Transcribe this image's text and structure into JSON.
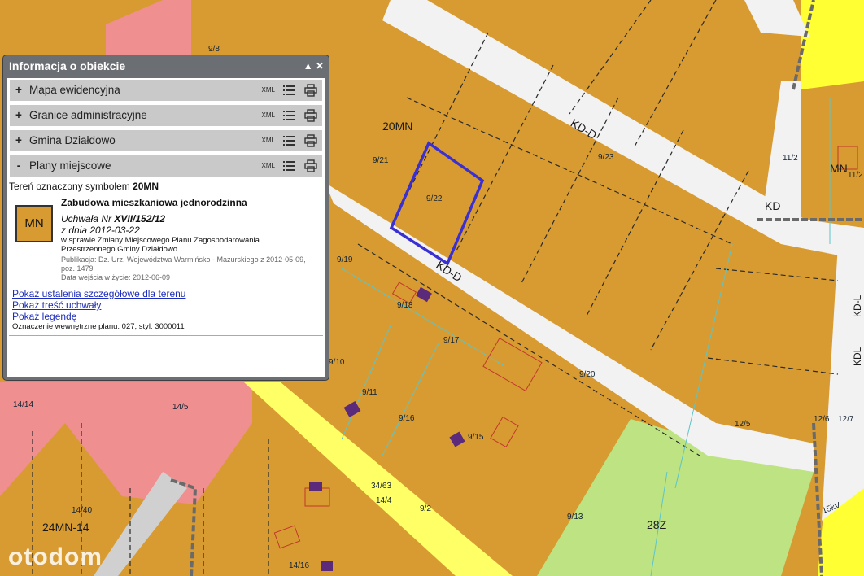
{
  "panel": {
    "title": "Informacja o obiekcie",
    "sections": [
      {
        "sign": "+",
        "title": "Mapa ewidencyjna",
        "xml": "XML"
      },
      {
        "sign": "+",
        "title": "Granice administracyjne",
        "xml": "XML"
      },
      {
        "sign": "+",
        "title": "Gmina Działdowo",
        "xml": "XML"
      },
      {
        "sign": "-",
        "title": "Plany miejscowe",
        "xml": "XML"
      }
    ],
    "details": {
      "symbol_prefix": "Tereń oznaczony symbolem",
      "symbol": "20MN",
      "zone_code": "MN",
      "zone_title": "Zabudowa mieszkaniowa jednorodzinna",
      "resolution_prefix": "Uchwała Nr",
      "resolution_number": "XVII/152/12",
      "resolution_date": "z dnia 2012-03-22",
      "resolution_subject": "w sprawie Zmiany Miejscowego Planu Zagospodarowania Przestrzennego Gminy Działdowo.",
      "publication": "Publikacja: Dz. Urz. Województwa Warmińsko - Mazurskiego z 2012-05-09, poz. 1479",
      "entry_into_force": "Data wejścia w życie: 2012-06-09",
      "links": [
        "Pokaż ustalenia szczegółowe dla terenu",
        "Pokaż treść uchwały",
        "Pokaż legendę"
      ],
      "internal": "Oznaczenie wewnętrzne planu: 027, styl: 3000011"
    }
  },
  "map": {
    "zone_labels": [
      "20MN",
      "KD-D",
      "KD-D",
      "KD",
      "28Z",
      "24MN-14",
      "KDL",
      "KD-L",
      "MN"
    ],
    "parcels": [
      "9/23",
      "9/22",
      "9/21",
      "9/19",
      "9/18",
      "9/17",
      "9/16",
      "9/15",
      "9/11",
      "9/10",
      "9/20",
      "9/13",
      "9/2",
      "34/63",
      "14/4",
      "14/5",
      "14/14",
      "14/40",
      "14/16",
      "12/5",
      "12/6",
      "11/2",
      "9/8",
      "11/2",
      "12/7"
    ],
    "line_label": "15kV",
    "colors": {
      "residential": "#d89b32",
      "green": "#bde383",
      "pink": "#f08f8f",
      "road": "#f2f2f2",
      "yellow": "#ffff33",
      "highlight": "#3a2fd0"
    }
  },
  "watermark": "otodom"
}
